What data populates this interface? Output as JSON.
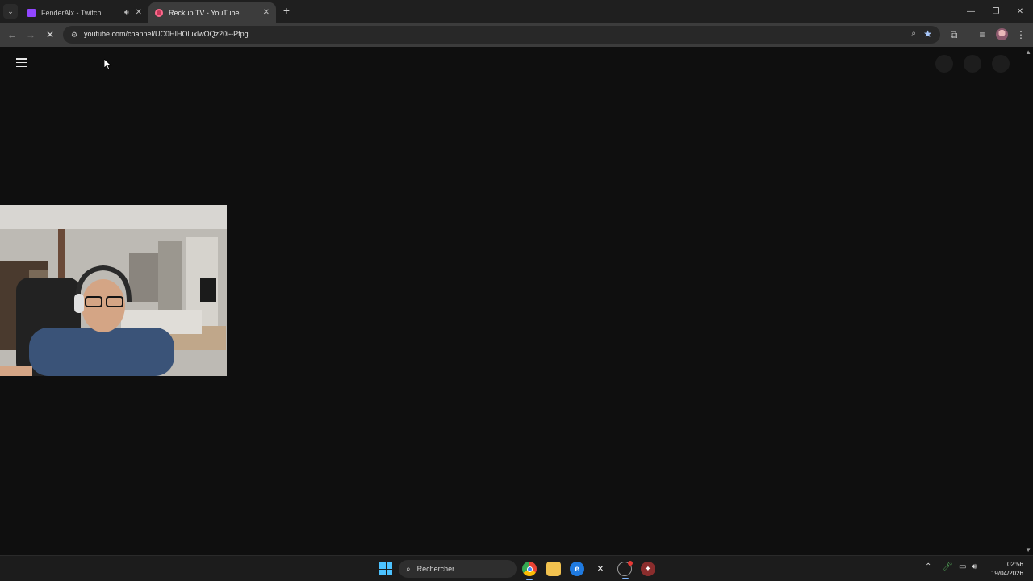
{
  "browser": {
    "tabs": [
      {
        "title": "FenderAlx - Twitch",
        "favicon": "twitch-icon",
        "audio": true,
        "active": false
      },
      {
        "title": "Reckup TV - YouTube",
        "favicon": "reckup-icon",
        "audio": false,
        "active": true
      }
    ],
    "url": "youtube.com/channel/UC0HIHOluxlwOQz20i--Pfpg"
  },
  "taskbar": {
    "search_placeholder": "Rechercher",
    "time": "02:56",
    "date": "19/04/2026",
    "apps": [
      "chrome-icon",
      "file-explorer-icon",
      "edge-icon",
      "capcut-icon",
      "obs-icon",
      "game-icon"
    ]
  },
  "colors": {
    "page_bg": "#0f0f0f",
    "tabstrip_bg": "#1f1f1f",
    "toolbar_bg": "#3c3c3c",
    "accent": "#4cc2ff"
  }
}
